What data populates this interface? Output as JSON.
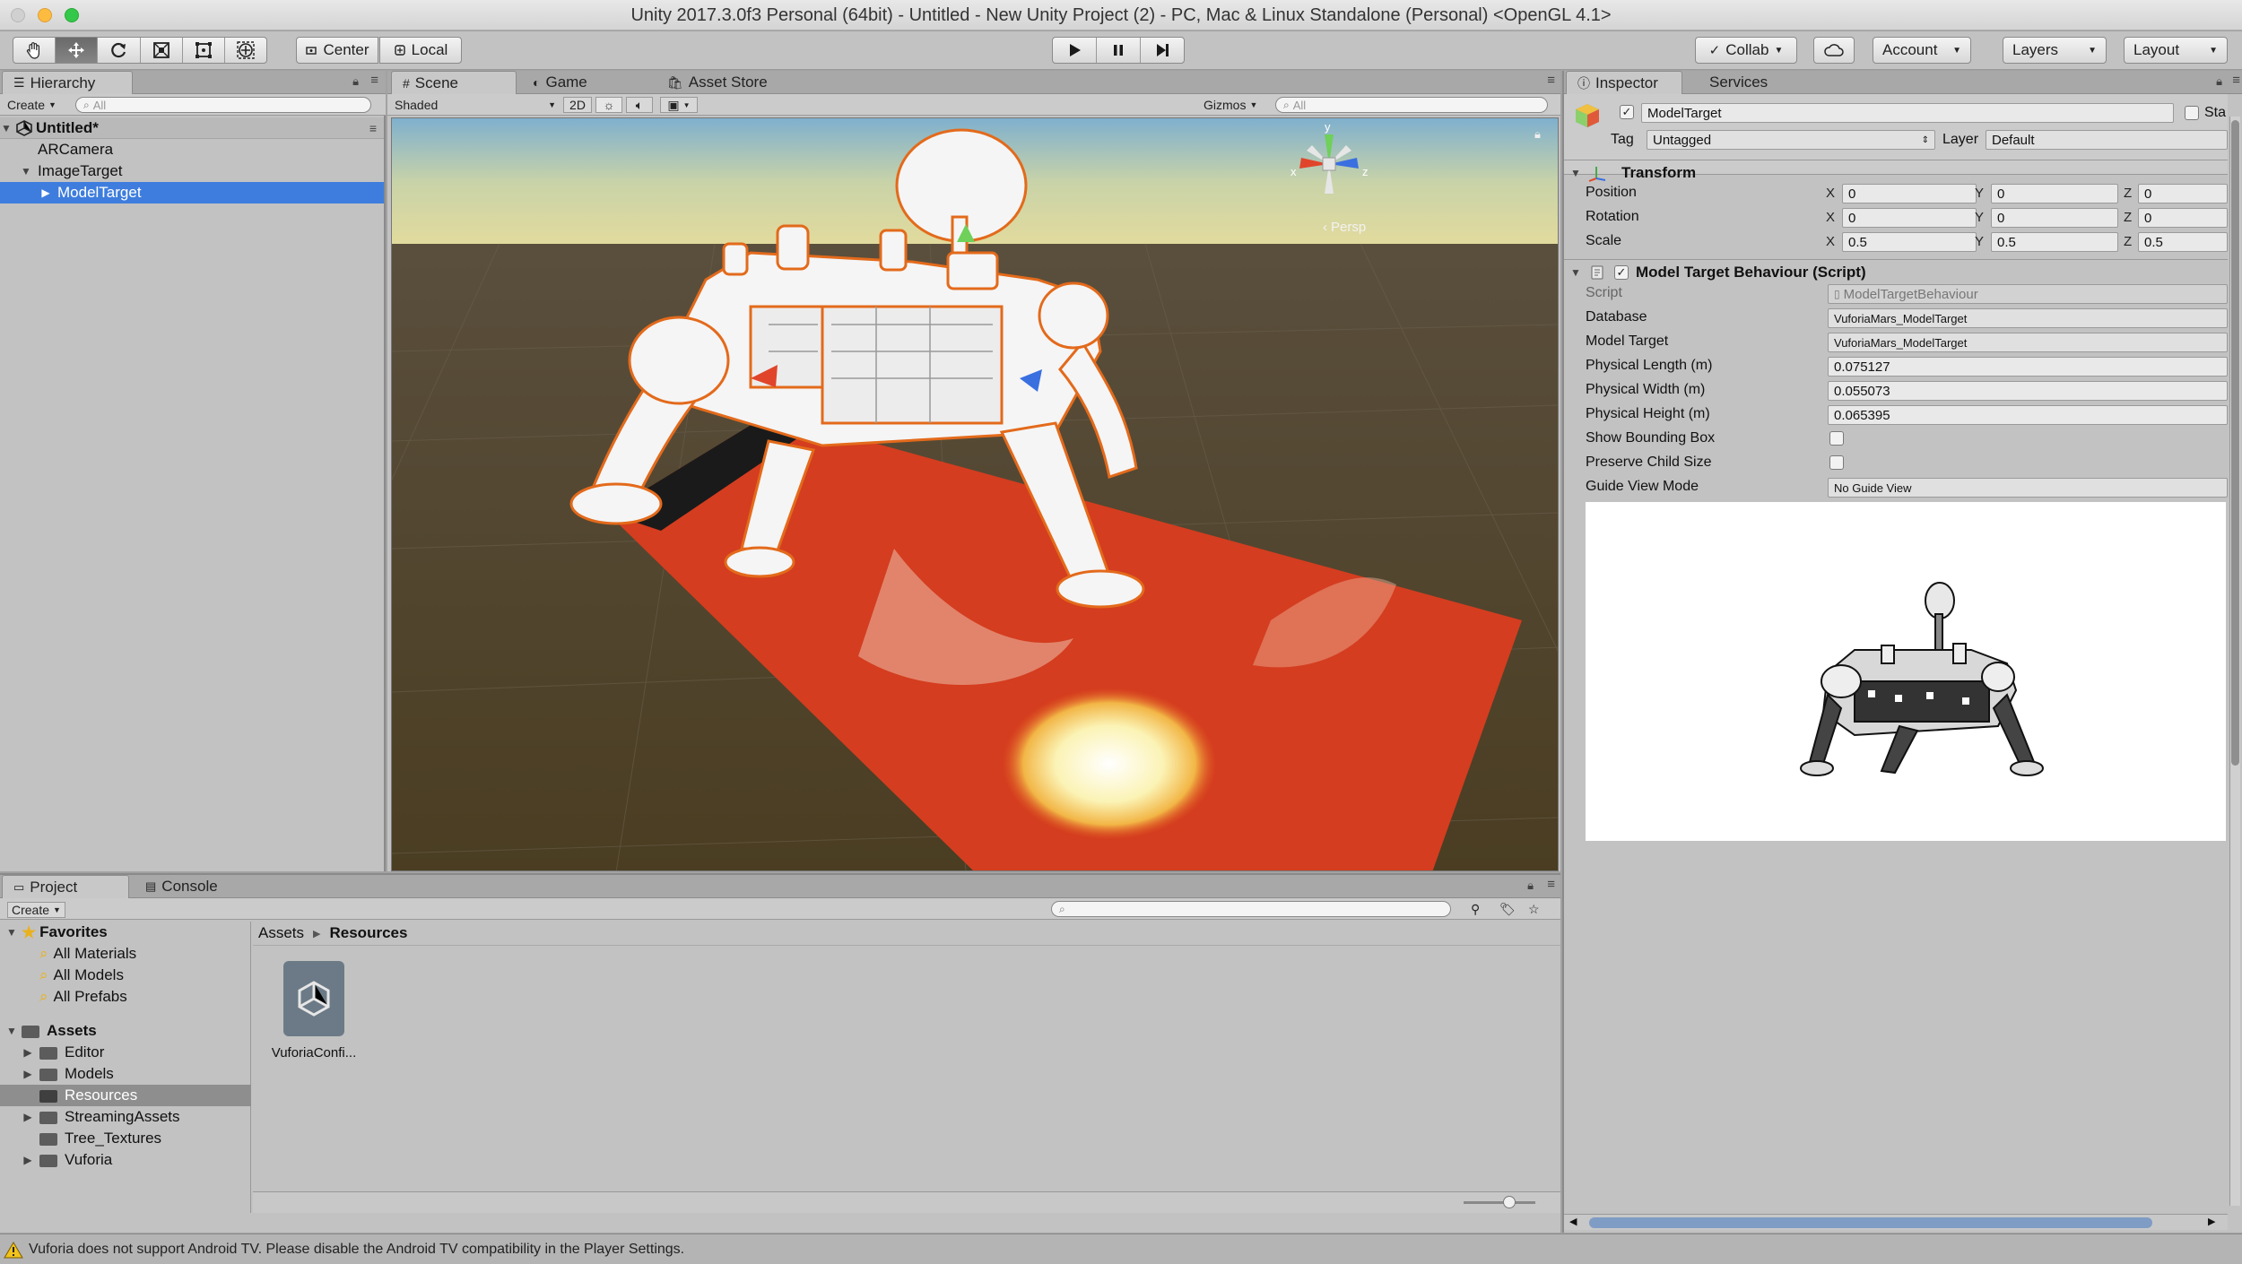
{
  "window": {
    "title": "Unity 2017.3.0f3 Personal (64bit) - Untitled - New Unity Project (2) - PC, Mac & Linux Standalone (Personal) <OpenGL 4.1>"
  },
  "toolbar": {
    "tools": [
      "hand-tool-icon",
      "move-tool-icon",
      "rotate-tool-icon",
      "scale-tool-icon",
      "rect-tool-icon",
      "transform-tool-icon"
    ],
    "pivot_label": "Center",
    "space_label": "Local",
    "collab_label": "Collab",
    "account_label": "Account",
    "layers_label": "Layers",
    "layout_label": "Layout"
  },
  "hierarchy": {
    "tab": "Hierarchy",
    "create_label": "Create",
    "search_placeholder": "All",
    "scene_name": "Untitled*",
    "items": [
      {
        "label": "ARCamera"
      },
      {
        "label": "ImageTarget"
      },
      {
        "label": "ModelTarget"
      }
    ]
  },
  "scene": {
    "tabs": [
      "Scene",
      "Game",
      "Asset Store"
    ],
    "shading_mode": "Shaded",
    "mode_2d": "2D",
    "gizmos_label": "Gizmos",
    "search_placeholder": "All",
    "persp_label": "Persp",
    "gizmo_axes": {
      "x": "x",
      "y": "y",
      "z": "z"
    }
  },
  "inspector": {
    "tabs": [
      "Inspector",
      "Services"
    ],
    "object_name": "ModelTarget",
    "static_label": "Sta",
    "tag_label": "Tag",
    "tag_value": "Untagged",
    "layer_label": "Layer",
    "layer_value": "Default",
    "transform": {
      "header": "Transform",
      "rows": [
        {
          "label": "Position",
          "x": "0",
          "y": "0",
          "z": "0"
        },
        {
          "label": "Rotation",
          "x": "0",
          "y": "0",
          "z": "0"
        },
        {
          "label": "Scale",
          "x": "0.5",
          "y": "0.5",
          "z": "0.5"
        }
      ]
    },
    "behaviour": {
      "header": "Model Target Behaviour (Script)",
      "script_label": "Script",
      "script_value": "ModelTargetBehaviour",
      "database_label": "Database",
      "database_value": "VuforiaMars_ModelTarget",
      "model_target_label": "Model Target",
      "model_target_value": "VuforiaMars_ModelTarget",
      "length_label": "Physical Length (m)",
      "length_value": "0.075127",
      "width_label": "Physical Width (m)",
      "width_value": "0.055073",
      "height_label": "Physical Height (m)",
      "height_value": "0.065395",
      "bbox_label": "Show Bounding Box",
      "preserve_label": "Preserve Child Size",
      "guide_label": "Guide View Mode",
      "guide_value": "No Guide View"
    }
  },
  "project": {
    "tabs": [
      "Project",
      "Console"
    ],
    "create_label": "Create",
    "favorites_label": "Favorites",
    "favorites": [
      "All Materials",
      "All Models",
      "All Prefabs"
    ],
    "assets_label": "Assets",
    "folders": [
      "Editor",
      "Models",
      "Resources",
      "StreamingAssets",
      "Tree_Textures",
      "Vuforia"
    ],
    "breadcrumb": [
      "Assets",
      "Resources"
    ],
    "files": [
      {
        "name": "VuforiaConfi..."
      }
    ]
  },
  "status": {
    "message": "Vuforia does not support Android TV. Please disable the Android TV compatibility in the Player Settings."
  }
}
